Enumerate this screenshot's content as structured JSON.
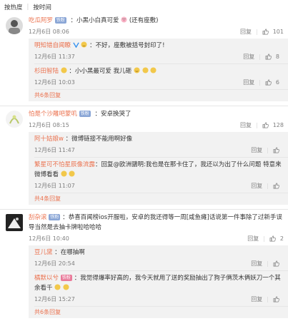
{
  "sort": {
    "hot": "按热度",
    "time": "按时间"
  },
  "comments": [
    {
      "user": "吃瓜阿罗",
      "badge": "铁粉",
      "text": "：小黑小白真可爱",
      "suffix": "(还有座敷)",
      "time": "12月6日 08:06",
      "reply": "回复",
      "likes": "101",
      "replies": [
        {
          "user": "明知错自闻瞭",
          "text": "：不好，座敷被括号封印了!",
          "time": "12月6日 11:37",
          "reply": "回复",
          "likes": "8"
        },
        {
          "user": "杉田智陆",
          "text": "：小小黑最可爱 我儿砸",
          "time": "12月6日 10:03",
          "reply": "回复",
          "likes": "6"
        }
      ],
      "more": "共6条回复"
    },
    {
      "user": "怕是个沙雕吧蒙叽",
      "badge": "铁粉",
      "text": "：安卓换哭了",
      "time": "12月6日 08:15",
      "reply": "回复",
      "likes": "128",
      "replies": [
        {
          "user": "阿十姑娘w",
          "text": "：微博链接不能用啊好像",
          "time": "12月6日 11:47",
          "reply": "回复",
          "likes": ""
        },
        {
          "user": "繁星可不怕星辰像流露",
          "text": "：回复@欧洲鶸明:我也是在那卡住了，我还以为出了什么问题 特意来微博看看",
          "time": "12月6日 11:07",
          "reply": "回复",
          "likes": ""
        }
      ],
      "more": "共4条回复"
    },
    {
      "user": "刮杂滚",
      "badge": "铁粉",
      "text": "：恭喜百闻榜ios开服啦，安卓的我还得等一周[咸鱼瘫]话说第一件事除了过新手误导当然是去抽卡牌啦哈哈哈",
      "time": "12月6日 10:40",
      "reply": "回复",
      "likes": "2",
      "replies": [
        {
          "user": "豆儿黛",
          "text": "：在哪抽啊",
          "time": "12月6日 20:54",
          "reply": "回复",
          "likes": ""
        },
        {
          "user": "橘默以兮",
          "badge": "铁粉",
          "text": "：我觉得爆率好高的，我今天就用了送的奖励抽出了狗子俩茨木俩妖刀一个其余看千",
          "time": "12月6日 15:27",
          "reply": "回复",
          "likes": ""
        }
      ],
      "more": "共6条回复"
    }
  ]
}
